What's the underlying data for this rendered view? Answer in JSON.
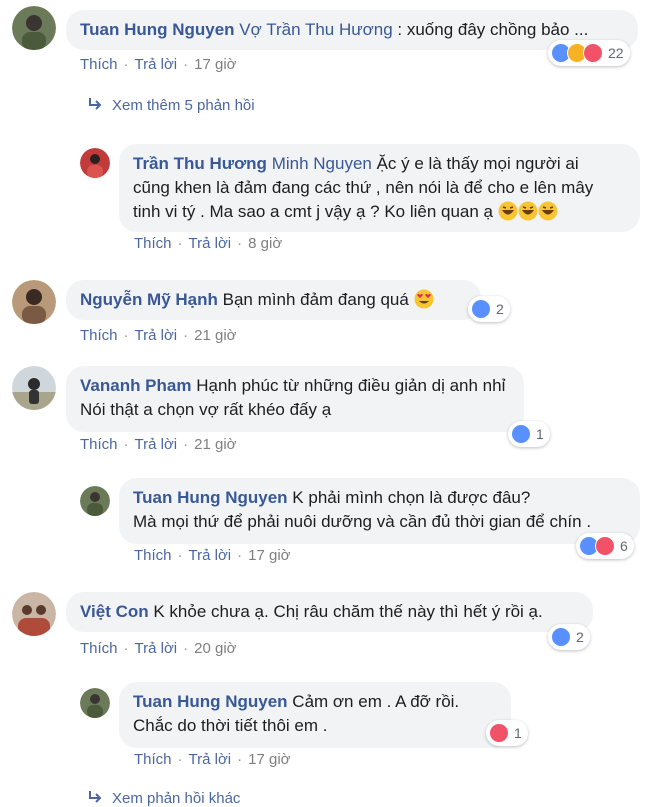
{
  "actions": {
    "like": "Thích",
    "reply": "Trả lời"
  },
  "comments": [
    {
      "author": "Tuan Hung Nguyen",
      "mention": "Vợ Trần Thu Hương",
      "text": ": xuống đây chồng bảo ...",
      "time": "17 giờ",
      "reactions": [
        "like",
        "haha",
        "love"
      ],
      "reaction_count": "22"
    },
    {
      "author": "Trần Thu Hương",
      "mention": "Minh Nguyen",
      "lines": [
        "Ặc ý e là thấy mọi người ai",
        "cũng khen là đảm đang các thứ , nên nói là để cho e lên mây",
        "tinh vi tý . Ma sao a cmt j vậy ạ ? Ko liên quan ạ"
      ],
      "time": "8 giờ"
    },
    {
      "author": "Nguyễn Mỹ Hạnh",
      "text": "Bạn mình đảm đang quá",
      "time": "21 giờ",
      "reactions": [
        "like"
      ],
      "reaction_count": "2"
    },
    {
      "author": "Vananh Pham",
      "lines": [
        "Hạnh phúc từ những điều giản dị anh nhỉ",
        "Nói thật a chọn vợ rất khéo đấy ạ"
      ],
      "time": "21 giờ",
      "reactions": [
        "like"
      ],
      "reaction_count": "1"
    },
    {
      "author": "Tuan Hung Nguyen",
      "lines": [
        "K phải mình chọn là được đâu?",
        "Mà mọi thứ để phải nuôi dưỡng và cần đủ thời gian để chín ."
      ],
      "time": "17 giờ",
      "reactions": [
        "like",
        "love"
      ],
      "reaction_count": "6"
    },
    {
      "author": "Việt Con",
      "text": "K khỏe chưa ạ. Chị râu chăm thế này thì hết ý rồi ạ.",
      "time": "20 giờ",
      "reactions": [
        "like"
      ],
      "reaction_count": "2"
    },
    {
      "author": "Tuan Hung Nguyen",
      "lines": [
        "Cảm ơn em . A đỡ rồi.",
        "Chắc do thời tiết thôi em ."
      ],
      "time": "17 giờ",
      "reactions": [
        "love"
      ],
      "reaction_count": "1"
    }
  ],
  "view_more_replies": "Xem thêm 5 phản hồi",
  "other_replies": "Xem phản hồi khác",
  "colors": {
    "link": "#385898",
    "bubble": "#f2f3f5",
    "like": "#5890ff",
    "love": "#f25268",
    "haha": "#f7b125"
  },
  "icons": {
    "reply_arrow": "reply-arrow-icon",
    "like": "like-reaction-icon",
    "love": "love-reaction-icon",
    "haha": "haha-reaction-icon",
    "emoji_laugh": "grinning-face-icon",
    "emoji_heart_eyes": "heart-eyes-face-icon"
  }
}
